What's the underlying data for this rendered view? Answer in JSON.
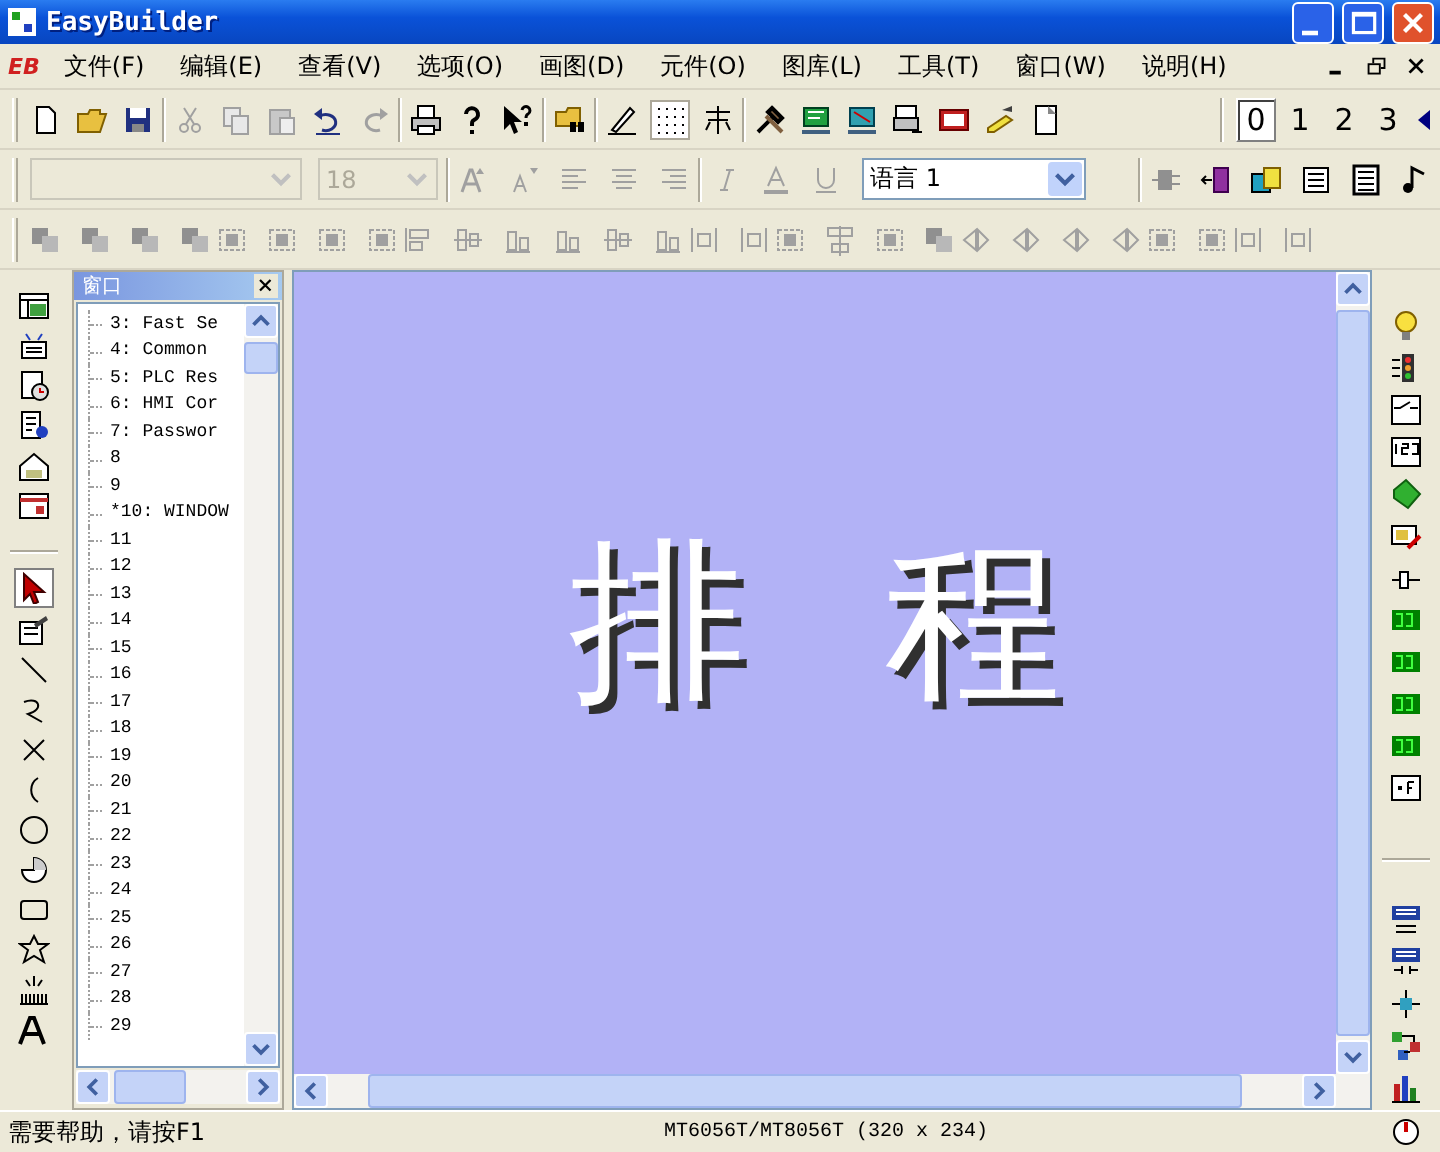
{
  "window": {
    "title": "EasyBuilder"
  },
  "menu_bar": {
    "logo": "EB",
    "items": [
      {
        "label": "文件(F)"
      },
      {
        "label": "编辑(E)"
      },
      {
        "label": "查看(V)"
      },
      {
        "label": "选项(O)"
      },
      {
        "label": "画图(D)"
      },
      {
        "label": "元件(O)"
      },
      {
        "label": "图库(L)"
      },
      {
        "label": "工具(T)"
      },
      {
        "label": "窗口(W)"
      },
      {
        "label": "说明(H)"
      }
    ]
  },
  "toolbar": {
    "pages": [
      {
        "label": "0",
        "selected": true
      },
      {
        "label": "1",
        "selected": false
      },
      {
        "label": "2",
        "selected": false
      },
      {
        "label": "3",
        "selected": false
      }
    ]
  },
  "format_bar": {
    "font_box": {
      "disabled": true
    },
    "size_box": {
      "value": "18",
      "disabled": true
    },
    "language_box": {
      "value": "语言 1"
    }
  },
  "window_panel": {
    "title": "窗口",
    "items": [
      {
        "label": "3: Fast Se"
      },
      {
        "label": "4: Common"
      },
      {
        "label": "5: PLC Res"
      },
      {
        "label": "6: HMI Cor"
      },
      {
        "label": "7: Passwor"
      },
      {
        "label": "8"
      },
      {
        "label": "9"
      },
      {
        "label": "*10: WINDOW"
      },
      {
        "label": "11"
      },
      {
        "label": "12"
      },
      {
        "label": "13"
      },
      {
        "label": "14"
      },
      {
        "label": "15"
      },
      {
        "label": "16"
      },
      {
        "label": "17"
      },
      {
        "label": "18"
      },
      {
        "label": "19"
      },
      {
        "label": "20"
      },
      {
        "label": "21"
      },
      {
        "label": "22"
      },
      {
        "label": "23"
      },
      {
        "label": "24"
      },
      {
        "label": "25"
      },
      {
        "label": "26"
      },
      {
        "label": "27"
      },
      {
        "label": "28"
      },
      {
        "label": "29"
      }
    ]
  },
  "canvas": {
    "text": "排程"
  },
  "status_bar": {
    "help": "需要帮助，请按F1",
    "model": "MT6056T/MT8056T (320 x 234)"
  }
}
